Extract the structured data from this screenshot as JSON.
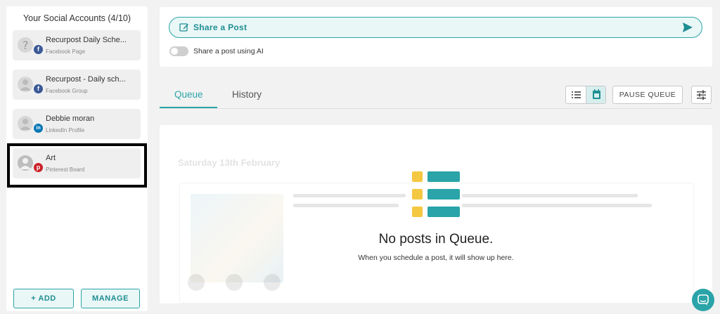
{
  "sidebar": {
    "title": "Your Social Accounts (4/10)",
    "accounts": [
      {
        "name": "Recurpost Daily Sche...",
        "type": "Facebook Page",
        "network_icon": "facebook-icon",
        "badge": "f"
      },
      {
        "name": "Recurpost - Daily sch...",
        "type": "Facebook Group",
        "network_icon": "facebook-icon",
        "badge": "f"
      },
      {
        "name": "Debbie moran",
        "type": "LinkedIn Profile",
        "network_icon": "linkedin-icon",
        "badge": "in"
      },
      {
        "name": "Art",
        "type": "Pinterest Board",
        "network_icon": "pinterest-icon",
        "badge": "p"
      }
    ],
    "add_label": "+ ADD",
    "manage_label": "MANAGE"
  },
  "share": {
    "label": "Share a Post",
    "ai_toggle_label": "Share a post using AI",
    "ai_toggle_on": false
  },
  "tabs": [
    {
      "label": "Queue",
      "active": true
    },
    {
      "label": "History",
      "active": false
    }
  ],
  "toolbar": {
    "pause_label": "PAUSE QUEUE",
    "view_mode": "calendar"
  },
  "queue": {
    "background_date": "Saturday 13th February",
    "empty_title": "No posts in Queue.",
    "empty_subtitle": "When you schedule a post, it will show up here."
  },
  "colors": {
    "accent": "#2aa4a8",
    "accent_light": "#eaf7f7",
    "empty_icon_yellow": "#f5c842",
    "highlight_border": "#000000"
  }
}
